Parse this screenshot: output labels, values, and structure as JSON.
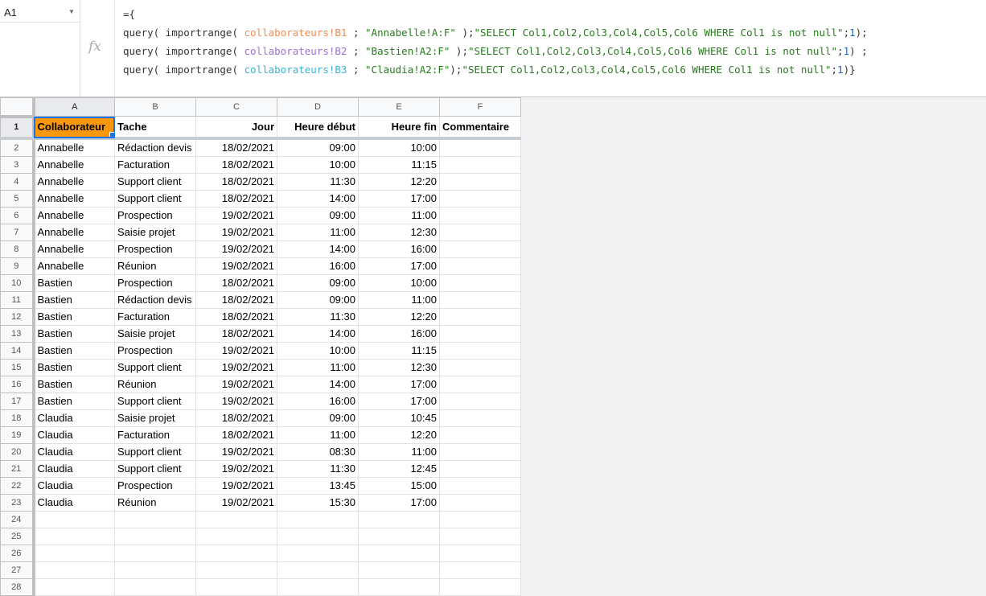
{
  "name_box": "A1",
  "fx_label": "fx",
  "formula": {
    "line0": "={",
    "l1": {
      "a": "query( importrange( ",
      "ref": "collaborateurs!B1",
      "b": " ; ",
      "str": "\"Annabelle!A:F\"",
      "c": " );",
      "q": "\"SELECT Col1,Col2,Col3,Col4,Col5,Col6 WHERE Col1 is not null\"",
      "d": ";",
      "n": "1",
      "e": ");"
    },
    "l2": {
      "a": "query( importrange( ",
      "ref": "collaborateurs!B2",
      "b": " ; ",
      "str": "\"Bastien!A2:F\"",
      "c": " );",
      "q": "\"SELECT Col1,Col2,Col3,Col4,Col5,Col6 WHERE Col1 is not null\"",
      "d": ";",
      "n": "1",
      "e": ") ;"
    },
    "l3": {
      "a": "query( importrange( ",
      "ref": "collaborateurs!B3",
      "b": " ; ",
      "str": "\"Claudia!A2:F\"",
      "c": ");",
      "q": "\"SELECT Col1,Col2,Col3,Col4,Col5,Col6 WHERE Col1 is not null\"",
      "d": ";",
      "n": "1",
      "e": ")}"
    }
  },
  "columns": [
    "A",
    "B",
    "C",
    "D",
    "E",
    "F"
  ],
  "header": [
    "Collaborateur",
    "Tache",
    "Jour",
    "Heure début",
    "Heure fin",
    "Commentaire"
  ],
  "rows": [
    [
      "Annabelle",
      "Rédaction devis",
      "18/02/2021",
      "09:00",
      "10:00",
      ""
    ],
    [
      "Annabelle",
      "Facturation",
      "18/02/2021",
      "10:00",
      "11:15",
      ""
    ],
    [
      "Annabelle",
      "Support client",
      "18/02/2021",
      "11:30",
      "12:20",
      ""
    ],
    [
      "Annabelle",
      "Support client",
      "18/02/2021",
      "14:00",
      "17:00",
      ""
    ],
    [
      "Annabelle",
      "Prospection",
      "19/02/2021",
      "09:00",
      "11:00",
      ""
    ],
    [
      "Annabelle",
      "Saisie projet",
      "19/02/2021",
      "11:00",
      "12:30",
      ""
    ],
    [
      "Annabelle",
      "Prospection",
      "19/02/2021",
      "14:00",
      "16:00",
      ""
    ],
    [
      "Annabelle",
      "Réunion",
      "19/02/2021",
      "16:00",
      "17:00",
      ""
    ],
    [
      "Bastien",
      "Prospection",
      "18/02/2021",
      "09:00",
      "10:00",
      ""
    ],
    [
      "Bastien",
      "Rédaction devis",
      "18/02/2021",
      "09:00",
      "11:00",
      ""
    ],
    [
      "Bastien",
      "Facturation",
      "18/02/2021",
      "11:30",
      "12:20",
      ""
    ],
    [
      "Bastien",
      "Saisie projet",
      "18/02/2021",
      "14:00",
      "16:00",
      ""
    ],
    [
      "Bastien",
      "Prospection",
      "19/02/2021",
      "10:00",
      "11:15",
      ""
    ],
    [
      "Bastien",
      "Support client",
      "19/02/2021",
      "11:00",
      "12:30",
      ""
    ],
    [
      "Bastien",
      "Réunion",
      "19/02/2021",
      "14:00",
      "17:00",
      ""
    ],
    [
      "Bastien",
      "Support client",
      "19/02/2021",
      "16:00",
      "17:00",
      ""
    ],
    [
      "Claudia",
      "Saisie projet",
      "18/02/2021",
      "09:00",
      "10:45",
      ""
    ],
    [
      "Claudia",
      "Facturation",
      "18/02/2021",
      "11:00",
      "12:20",
      ""
    ],
    [
      "Claudia",
      "Support client",
      "19/02/2021",
      "08:30",
      "11:00",
      ""
    ],
    [
      "Claudia",
      "Support client",
      "19/02/2021",
      "11:30",
      "12:45",
      ""
    ],
    [
      "Claudia",
      "Prospection",
      "19/02/2021",
      "13:45",
      "15:00",
      ""
    ],
    [
      "Claudia",
      "Réunion",
      "19/02/2021",
      "15:30",
      "17:00",
      ""
    ],
    [
      "",
      "",
      "",
      "",
      "",
      ""
    ],
    [
      "",
      "",
      "",
      "",
      "",
      ""
    ],
    [
      "",
      "",
      "",
      "",
      "",
      ""
    ],
    [
      "",
      "",
      "",
      "",
      "",
      ""
    ],
    [
      "",
      "",
      "",
      "",
      "",
      ""
    ]
  ],
  "row_numbers": [
    "1",
    "2",
    "3",
    "4",
    "5",
    "6",
    "7",
    "8",
    "9",
    "10",
    "11",
    "12",
    "13",
    "14",
    "15",
    "16",
    "17",
    "18",
    "19",
    "20",
    "21",
    "22",
    "23",
    "24",
    "25",
    "26",
    "27",
    "28"
  ],
  "colors": {
    "header_fill": "#f9980d",
    "selection": "#1a73e8"
  }
}
